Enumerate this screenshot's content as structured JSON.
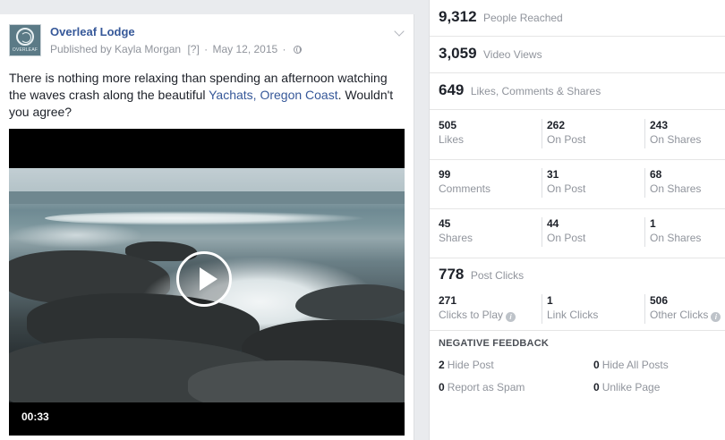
{
  "post": {
    "page_name": "Overleaf Lodge",
    "published_by": "Published by Kayla Morgan",
    "help_marker": "[?]",
    "date": "May 12, 2015",
    "avatar_text": "OVERLEAF",
    "text_before": "There is nothing more relaxing than spending an afternoon watching the waves crash along the beautiful ",
    "text_link": "Yachats, Oregon Coast",
    "text_after": ". Wouldn't you agree?",
    "video_duration": "00:33"
  },
  "stats": {
    "people_reached": {
      "value": "9,312",
      "label": "People Reached"
    },
    "video_views": {
      "value": "3,059",
      "label": "Video Views"
    },
    "engagement": {
      "value": "649",
      "label": "Likes, Comments & Shares"
    },
    "likes": {
      "total": "505",
      "total_label": "Likes",
      "on_post": "262",
      "on_post_label": "On Post",
      "on_shares": "243",
      "on_shares_label": "On Shares"
    },
    "comments": {
      "total": "99",
      "total_label": "Comments",
      "on_post": "31",
      "on_post_label": "On Post",
      "on_shares": "68",
      "on_shares_label": "On Shares"
    },
    "shares": {
      "total": "45",
      "total_label": "Shares",
      "on_post": "44",
      "on_post_label": "On Post",
      "on_shares": "1",
      "on_shares_label": "On Shares"
    },
    "post_clicks": {
      "value": "778",
      "label": "Post Clicks"
    },
    "clicks": {
      "play": "271",
      "play_label": "Clicks to Play",
      "link": "1",
      "link_label": "Link Clicks",
      "other": "506",
      "other_label": "Other Clicks"
    },
    "negative_feedback": {
      "heading": "NEGATIVE FEEDBACK",
      "hide_post": {
        "value": "2",
        "label": "Hide Post"
      },
      "hide_all": {
        "value": "0",
        "label": "Hide All Posts"
      },
      "spam": {
        "value": "0",
        "label": "Report as Spam"
      },
      "unlike": {
        "value": "0",
        "label": "Unlike Page"
      }
    }
  },
  "icons": {
    "info": "i"
  }
}
